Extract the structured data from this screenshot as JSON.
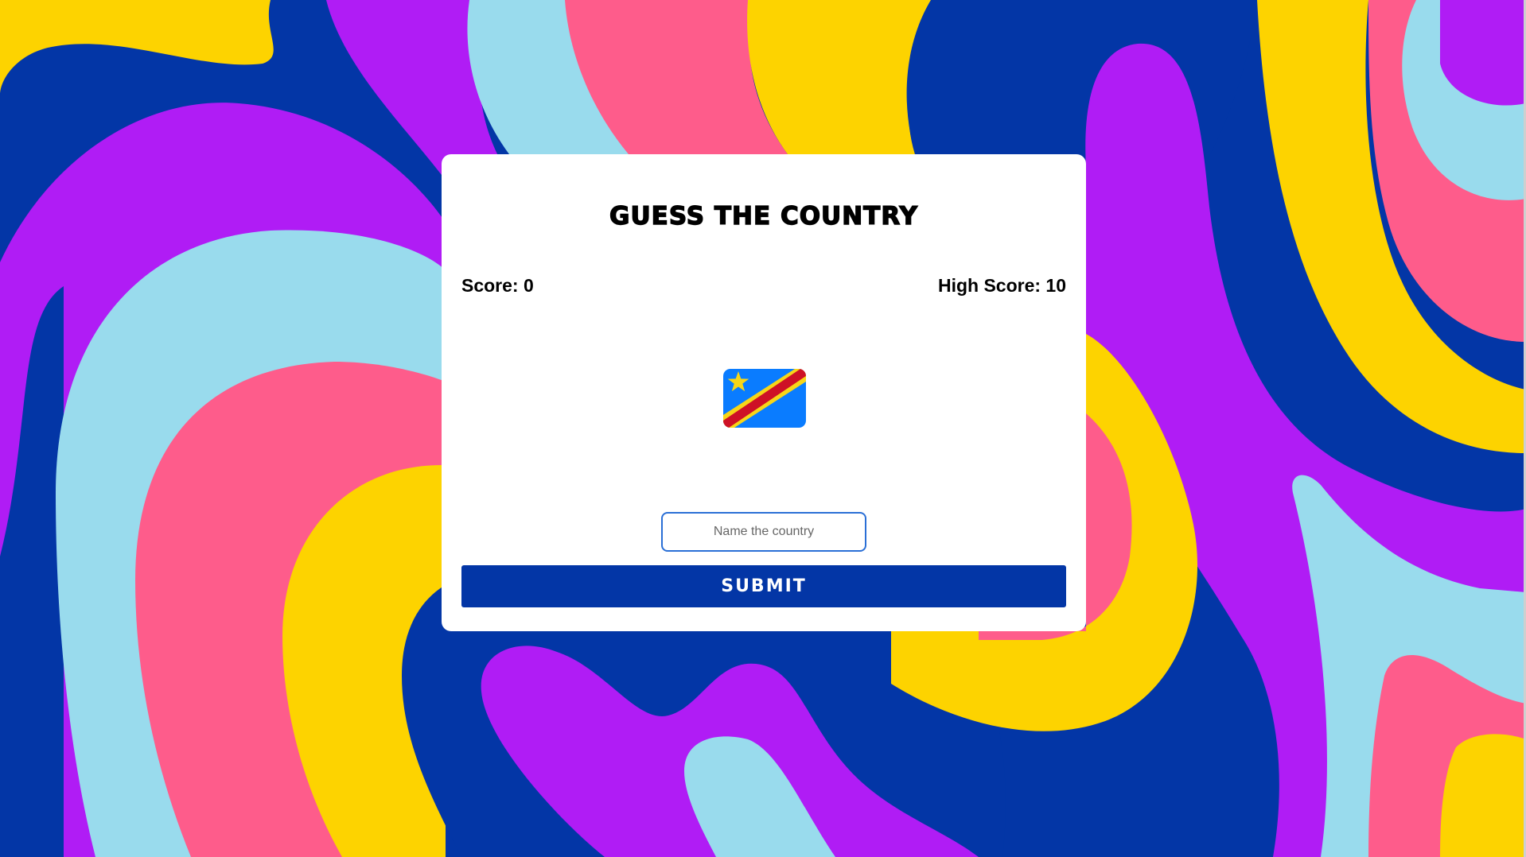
{
  "game": {
    "title": "GUESS THE COUNTRY",
    "score_text": "Score: 0",
    "high_score_text": "High Score: 10",
    "flag": {
      "icon": "flag-dr-congo-icon",
      "colors": {
        "field": "#0a7cff",
        "stripe": "#ce1126",
        "border_stripe": "#f7d618",
        "star": "#f7d618"
      }
    },
    "input": {
      "placeholder": "Name the country",
      "value": ""
    },
    "submit_label": "SUBMIT"
  },
  "theme": {
    "background_colors": [
      "#0336a6",
      "#b01cf5",
      "#99dbed",
      "#fe5c8b",
      "#fdd300"
    ],
    "accent": "#0336a6",
    "card": "#ffffff"
  }
}
